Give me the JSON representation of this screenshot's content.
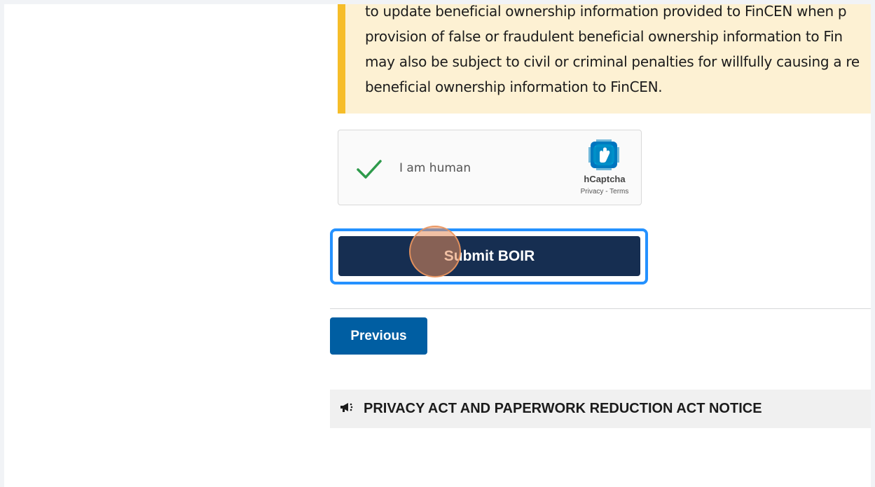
{
  "alert": {
    "lines": [
      "to update beneficial ownership information provided to FinCEN when p",
      "provision of false or fraudulent beneficial ownership information to Fin",
      "may also be subject to civil or criminal penalties for willfully causing a re",
      "beneficial ownership information to FinCEN."
    ]
  },
  "captcha": {
    "label": "I am human",
    "brand": "hCaptcha",
    "links": "Privacy - Terms",
    "icon": "hcaptcha-logo-icon",
    "check_icon": "checkmark-icon"
  },
  "actions": {
    "submit_label": "Submit BOIR",
    "previous_label": "Previous"
  },
  "notice": {
    "icon": "megaphone-icon",
    "title": "PRIVACY ACT AND PAPERWORK REDUCTION ACT NOTICE"
  },
  "colors": {
    "alert_bg": "#fdf1d3",
    "alert_border": "#f6bd29",
    "submit_bg": "#162e51",
    "focus_ring": "#2491ff",
    "previous_bg": "#005ea2",
    "check": "#2e9a4b"
  }
}
